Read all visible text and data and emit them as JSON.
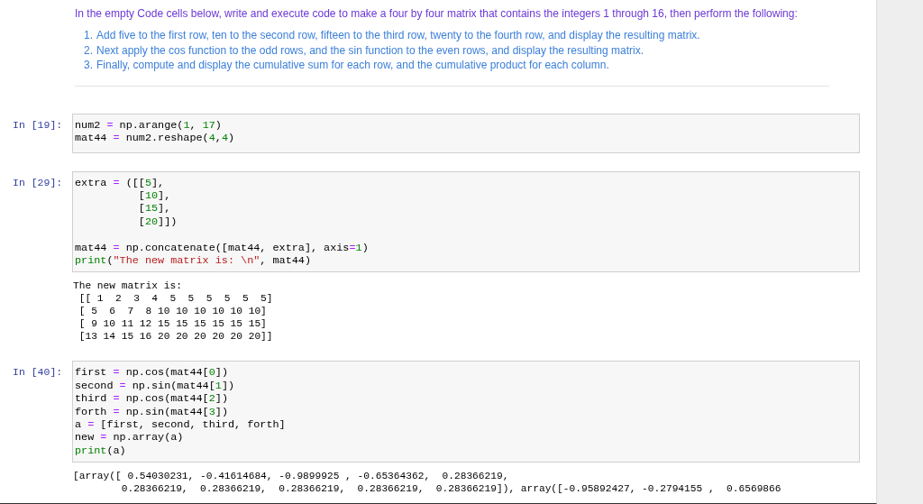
{
  "markdown": {
    "intro": "In the empty Code cells below, write and execute code to make a four by four matrix that contains the integers 1 through 16, then perform the following:",
    "steps": [
      {
        "number": "1.",
        "text": "Add five to the first row, ten to the second row, fifteen to the third row, twenty to the fourth row, and display the resulting matrix."
      },
      {
        "number": "2.",
        "text": "Next apply the cos function to the odd rows, and the sin function to the even rows, and display the resulting matrix."
      },
      {
        "number": "3.",
        "text": "Finally, compute and display the cumulative sum for each row, and the cumulative product for each column."
      }
    ]
  },
  "cells": [
    {
      "prompt": "In [19]:",
      "lines": [
        {
          "tokens": [
            {
              "text": "num2 ",
              "kind": "name"
            },
            {
              "text": "=",
              "kind": "operator"
            },
            {
              "text": " np.arange(",
              "kind": "name"
            },
            {
              "text": "1",
              "kind": "number"
            },
            {
              "text": ", ",
              "kind": "name"
            },
            {
              "text": "17",
              "kind": "number"
            },
            {
              "text": ")",
              "kind": "name"
            }
          ]
        },
        {
          "tokens": [
            {
              "text": "mat44 ",
              "kind": "name"
            },
            {
              "text": "=",
              "kind": "operator"
            },
            {
              "text": " num2.reshape(",
              "kind": "name"
            },
            {
              "text": "4",
              "kind": "number"
            },
            {
              "text": ",",
              "kind": "name"
            },
            {
              "text": "4",
              "kind": "number"
            },
            {
              "text": ")",
              "kind": "name"
            }
          ]
        }
      ]
    },
    {
      "prompt": "In [29]:",
      "lines": [
        {
          "tokens": [
            {
              "text": "extra ",
              "kind": "name"
            },
            {
              "text": "=",
              "kind": "operator"
            },
            {
              "text": " ([[",
              "kind": "name"
            },
            {
              "text": "5",
              "kind": "number"
            },
            {
              "text": "],",
              "kind": "name"
            }
          ]
        },
        {
          "tokens": [
            {
              "text": "          [",
              "kind": "name"
            },
            {
              "text": "10",
              "kind": "number"
            },
            {
              "text": "],",
              "kind": "name"
            }
          ]
        },
        {
          "tokens": [
            {
              "text": "          [",
              "kind": "name"
            },
            {
              "text": "15",
              "kind": "number"
            },
            {
              "text": "],",
              "kind": "name"
            }
          ]
        },
        {
          "tokens": [
            {
              "text": "          [",
              "kind": "name"
            },
            {
              "text": "20",
              "kind": "number"
            },
            {
              "text": "]])",
              "kind": "name"
            }
          ]
        },
        {
          "spaced": true,
          "tokens": [
            {
              "text": "mat44 ",
              "kind": "name"
            },
            {
              "text": "=",
              "kind": "operator"
            },
            {
              "text": " np.concatenate([mat44, extra], axis",
              "kind": "name"
            },
            {
              "text": "=",
              "kind": "operator"
            },
            {
              "text": "1",
              "kind": "number"
            },
            {
              "text": ")",
              "kind": "name"
            }
          ]
        },
        {
          "tokens": [
            {
              "text": "print",
              "kind": "builtin"
            },
            {
              "text": "(",
              "kind": "name"
            },
            {
              "text": "\"The new matrix is: \\n\"",
              "kind": "string"
            },
            {
              "text": ", mat44)",
              "kind": "name"
            }
          ]
        }
      ],
      "output": [
        "The new matrix is: ",
        " [[ 1  2  3  4  5  5  5  5  5  5]",
        " [ 5  6  7  8 10 10 10 10 10 10]",
        " [ 9 10 11 12 15 15 15 15 15 15]",
        " [13 14 15 16 20 20 20 20 20 20]]"
      ]
    },
    {
      "prompt": "In [40]:",
      "lines": [
        {
          "tokens": [
            {
              "text": "first ",
              "kind": "name"
            },
            {
              "text": "=",
              "kind": "operator"
            },
            {
              "text": " np.cos(mat44[",
              "kind": "name"
            },
            {
              "text": "0",
              "kind": "number"
            },
            {
              "text": "])",
              "kind": "name"
            }
          ]
        },
        {
          "tokens": [
            {
              "text": "second ",
              "kind": "name"
            },
            {
              "text": "=",
              "kind": "operator"
            },
            {
              "text": " np.sin(mat44[",
              "kind": "name"
            },
            {
              "text": "1",
              "kind": "number"
            },
            {
              "text": "])",
              "kind": "name"
            }
          ]
        },
        {
          "tokens": [
            {
              "text": "third ",
              "kind": "name"
            },
            {
              "text": "=",
              "kind": "operator"
            },
            {
              "text": " np.cos(mat44[",
              "kind": "name"
            },
            {
              "text": "2",
              "kind": "number"
            },
            {
              "text": "])",
              "kind": "name"
            }
          ]
        },
        {
          "tokens": [
            {
              "text": "forth ",
              "kind": "name"
            },
            {
              "text": "=",
              "kind": "operator"
            },
            {
              "text": " np.sin(mat44[",
              "kind": "name"
            },
            {
              "text": "3",
              "kind": "number"
            },
            {
              "text": "])",
              "kind": "name"
            }
          ]
        },
        {
          "tokens": [
            {
              "text": "a ",
              "kind": "name"
            },
            {
              "text": "=",
              "kind": "operator"
            },
            {
              "text": " [first, second, third, forth]",
              "kind": "name"
            }
          ]
        },
        {
          "tokens": [
            {
              "text": "new ",
              "kind": "name"
            },
            {
              "text": "=",
              "kind": "operator"
            },
            {
              "text": " np.array(a)",
              "kind": "name"
            }
          ]
        },
        {
          "tokens": [
            {
              "text": "print",
              "kind": "builtin"
            },
            {
              "text": "(a)",
              "kind": "name"
            }
          ]
        }
      ],
      "output": [
        "[array([ 0.54030231, -0.41614684, -0.9899925 , -0.65364362,  0.28366219,",
        "        0.28366219,  0.28366219,  0.28366219,  0.28366219,  0.28366219]), array([-0.95892427, -0.2794155 ,  0.6569866"
      ]
    }
  ]
}
